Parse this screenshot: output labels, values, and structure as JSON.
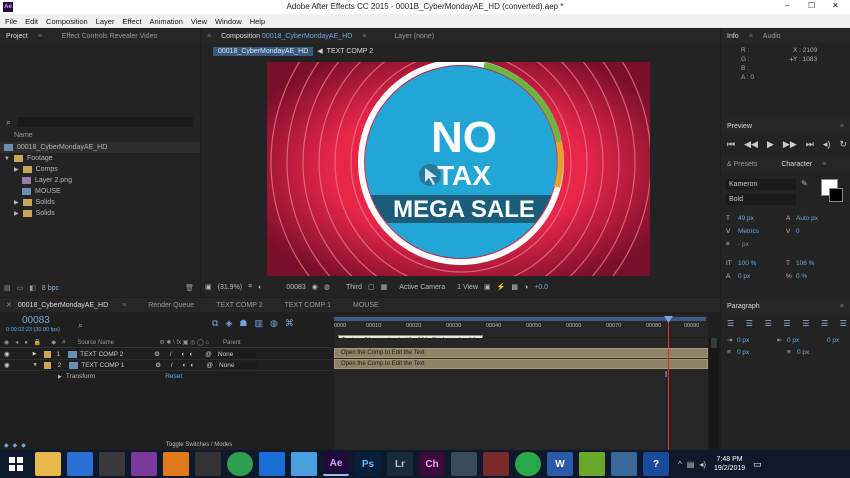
{
  "app": {
    "title": "Adobe After Effects CC 2015 - 0001B_CyberMondayAE_HD (converted).aep *",
    "logo_text": "Ae"
  },
  "menu": [
    "File",
    "Edit",
    "Composition",
    "Layer",
    "Effect",
    "Animation",
    "View",
    "Window",
    "Help"
  ],
  "window_controls": [
    "–",
    "☐",
    "✕"
  ],
  "project_panel": {
    "tab": "Project",
    "tab2": "Effect Controls Revealer Video",
    "search_icon": "search-icon",
    "column_name": "Name",
    "items": [
      {
        "label": "00018_CyberMondayAE_HD",
        "type": "comp",
        "indent": 0
      },
      {
        "label": "Footage",
        "type": "folder",
        "indent": 0
      },
      {
        "label": "Comps",
        "type": "folder",
        "indent": 1
      },
      {
        "label": "Layer 2.png",
        "type": "file",
        "indent": 1
      },
      {
        "label": "MOUSE",
        "type": "comp",
        "indent": 1
      },
      {
        "label": "Solids",
        "type": "folder",
        "indent": 1
      },
      {
        "label": "Solids",
        "type": "folder",
        "indent": 1
      }
    ],
    "bpc": "8 bpc"
  },
  "comp_panel": {
    "tab_prefix": "Composition",
    "tab_comp": "00018_CyberMondayAE_HD",
    "tab_layer": "Layer (none)",
    "breadcrumb_active": "00018_CyberMondayAE_HD",
    "breadcrumb_next": "TEXT COMP 2",
    "art": {
      "line1": "NO",
      "line2": "TAX",
      "line3": "MEGA SALE",
      "bg_color": "#e8264a",
      "circle_color": "#22a6d6",
      "band_color": "#1b5d78"
    },
    "zoom": "(31.9%)",
    "timecode": "00083",
    "resolution": "Third",
    "camera": "Active Camera",
    "views": "1 View",
    "exposure": "+0.0"
  },
  "info_panel": {
    "tab": "Info",
    "tab2": "Audio",
    "r": "R :",
    "g": "G :",
    "b": "B :",
    "a": "A : 0",
    "x": "X : 2109",
    "y": "Y : 1083"
  },
  "preview_panel": {
    "tab": "Preview"
  },
  "character_panel": {
    "tab_presets": "& Presets",
    "tab": "Character",
    "font": "Kameron",
    "style": "Bold",
    "size": "49 px",
    "leading": "Auto px",
    "kerning": "Metrics",
    "tracking": "0",
    "stroke": "- px",
    "vscale": "100 %",
    "hscale": "106 %",
    "baseline": "0 px",
    "tsume": "0 %"
  },
  "paragraph_panel": {
    "tab": "Paragraph",
    "indent_values": [
      "0 px",
      "0 px",
      "0 px",
      "0 px",
      "0 px"
    ]
  },
  "timeline": {
    "tabs": [
      "00018_CyberMondayAE_HD",
      "Render Queue",
      "TEXT COMP 2",
      "TEXT COMP 1",
      "MOUSE"
    ],
    "timecode": "00083",
    "timecode_sub": "0:00:02:23 (30.00 fps)",
    "col_source": "Source Name",
    "col_parent": "Parent",
    "layers": [
      {
        "num": "1",
        "name": "TEXT COMP 2",
        "parent": "None"
      },
      {
        "num": "2",
        "name": "TEXT COMP 1",
        "parent": "None"
      }
    ],
    "transform_label": "Transform",
    "transform_reset": "Reset",
    "ruler": [
      "0000",
      "00010",
      "00020",
      "00030",
      "00040",
      "00050",
      "00060",
      "00070",
      "00080",
      "00090"
    ],
    "tooltip": "To view all layers, deselect the 'Hide Shy Layers' switch.",
    "bar_label": "Open the Comp to Edit the Text",
    "toggle": "Toggle Switches / Modes",
    "playhead_frame": 83
  },
  "taskbar": {
    "time": "7:48 PM",
    "date": "19/2/2019",
    "apps": [
      {
        "name": "explorer",
        "label": "",
        "color": "#e8b84a"
      },
      {
        "name": "dropbox",
        "label": "",
        "color": "#2a6fd6"
      },
      {
        "name": "app3",
        "label": "",
        "color": "#3a3a3a"
      },
      {
        "name": "app4",
        "label": "",
        "color": "#7a3a9a"
      },
      {
        "name": "vlc",
        "label": "",
        "color": "#e07a1a"
      },
      {
        "name": "app6",
        "label": "",
        "color": "#333"
      },
      {
        "name": "chrome",
        "label": "",
        "color": "#2f9e4f"
      },
      {
        "name": "teamviewer",
        "label": "",
        "color": "#1a6fd6"
      },
      {
        "name": "player",
        "label": "",
        "color": "#4aa0e0"
      },
      {
        "name": "ae",
        "label": "Ae",
        "color": "#1f0a3a"
      },
      {
        "name": "ps",
        "label": "Ps",
        "color": "#0a1f3a"
      },
      {
        "name": "lr",
        "label": "Lr",
        "color": "#1a2a3a"
      },
      {
        "name": "ch",
        "label": "Ch",
        "color": "#3a0a3a"
      },
      {
        "name": "app14",
        "label": "",
        "color": "#3a4a5a"
      },
      {
        "name": "app15",
        "label": "",
        "color": "#7a2a2a"
      },
      {
        "name": "whatsapp",
        "label": "",
        "color": "#2aa84a"
      },
      {
        "name": "word",
        "label": "W",
        "color": "#2a5aa8"
      },
      {
        "name": "utorrent",
        "label": "",
        "color": "#6aa82a"
      },
      {
        "name": "photos",
        "label": "",
        "color": "#3a6a9a"
      },
      {
        "name": "help",
        "label": "?",
        "color": "#1a4a9a"
      }
    ]
  }
}
